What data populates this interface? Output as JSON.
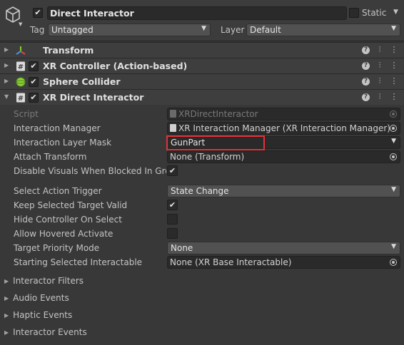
{
  "header": {
    "name": "Direct Interactor",
    "static_label": "Static",
    "tag_label": "Tag",
    "tag_value": "Untagged",
    "layer_label": "Layer",
    "layer_value": "Default"
  },
  "components": [
    {
      "title": "Transform",
      "icon": "transform-axes-icon"
    },
    {
      "title": "XR Controller (Action-based)",
      "icon": "script-hash-icon"
    },
    {
      "title": "Sphere Collider",
      "icon": "sphere-collider-icon"
    },
    {
      "title": "XR Direct Interactor",
      "icon": "script-hash-icon"
    }
  ],
  "properties": {
    "script_label": "Script",
    "script_value": "XRDirectInteractor",
    "interaction_manager_label": "Interaction Manager",
    "interaction_manager_value": "XR Interaction Manager (XR Interaction Manager)",
    "interaction_layer_mask_label": "Interaction Layer Mask",
    "interaction_layer_mask_value": "GunPart",
    "attach_transform_label": "Attach Transform",
    "attach_transform_value": "None (Transform)",
    "disable_visuals_label": "Disable Visuals When Blocked In Group",
    "disable_visuals_checked": true,
    "select_action_trigger_label": "Select Action Trigger",
    "select_action_trigger_value": "State Change",
    "keep_selected_label": "Keep Selected Target Valid",
    "keep_selected_checked": true,
    "hide_controller_label": "Hide Controller On Select",
    "hide_controller_checked": false,
    "allow_hovered_label": "Allow Hovered Activate",
    "allow_hovered_checked": false,
    "target_priority_label": "Target Priority Mode",
    "target_priority_value": "None",
    "starting_selected_label": "Starting Selected Interactable",
    "starting_selected_value": "None (XR Base Interactable)"
  },
  "sections": [
    "Interactor Filters",
    "Audio Events",
    "Haptic Events",
    "Interactor Events"
  ],
  "colors": {
    "highlight": "#e0333a",
    "background": "#383838",
    "header": "#3c3c3c"
  }
}
